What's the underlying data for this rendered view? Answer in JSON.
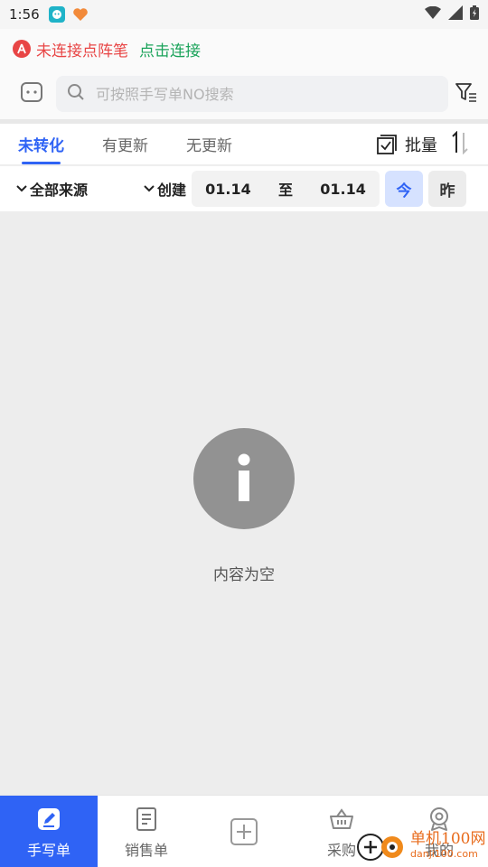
{
  "status_bar": {
    "time": "1:56"
  },
  "connection": {
    "status_text": "未连接点阵笔",
    "action_text": "点击连接",
    "status_color": "#e84545",
    "action_color": "#1aa35a"
  },
  "search": {
    "placeholder": "可按照手写单NO搜索",
    "value": ""
  },
  "tabs": [
    {
      "label": "未转化",
      "active": true
    },
    {
      "label": "有更新",
      "active": false
    },
    {
      "label": "无更新",
      "active": false
    }
  ],
  "toolbar": {
    "batch_label": "批量"
  },
  "filters": {
    "source_label": "全部来源",
    "date_type_label": "创建",
    "date_from": "01.14",
    "date_separator": "至",
    "date_to": "01.14",
    "today_label": "今",
    "yesterday_label": "昨"
  },
  "empty_state": {
    "text": "内容为空"
  },
  "bottom_nav": [
    {
      "label": "手写单",
      "icon": "edit-note-icon",
      "active": true
    },
    {
      "label": "销售单",
      "icon": "document-icon",
      "active": false
    },
    {
      "label": "",
      "icon": "add-square-icon",
      "active": false
    },
    {
      "label": "采购",
      "icon": "basket-icon",
      "active": false
    },
    {
      "label": "我的",
      "icon": "profile-icon",
      "active": false
    }
  ],
  "watermark": {
    "name": "单机100网",
    "url": "danji100.com"
  },
  "colors": {
    "accent": "#2f63f5",
    "accent_light": "#d6e2ff",
    "background": "#ededed"
  }
}
